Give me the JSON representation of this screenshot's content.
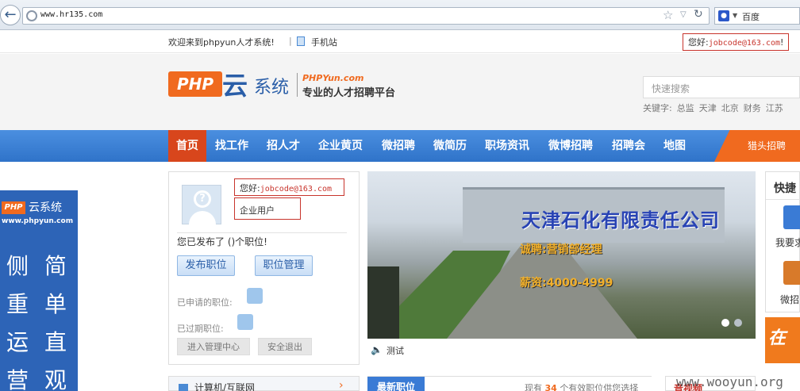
{
  "browser": {
    "url": "www.hr135.com",
    "search_engine": "百度"
  },
  "topstrip": {
    "welcome": "欢迎来到phpyun人才系统!",
    "separator": "|",
    "mobile_link": "手机站",
    "hello_prefix": "您好:",
    "hello_user": "jobcode@163.com",
    "hello_suffix": "!"
  },
  "header": {
    "logo_php": "PHP",
    "logo_yun": "云",
    "logo_sys": "系统",
    "logo_sub": "PHPYun.com",
    "logo_slogan": "专业的人才招聘平台",
    "search_placeholder": "快速搜索",
    "keywords_label": "关键字:",
    "keywords": [
      "总监",
      "天津",
      "北京",
      "财务",
      "江苏"
    ]
  },
  "nav": {
    "items": [
      "首页",
      "找工作",
      "招人才",
      "企业黄页",
      "微招聘",
      "微简历",
      "职场资讯",
      "微博招聘",
      "招聘会",
      "地图"
    ],
    "hunter": "猎头招聘"
  },
  "sidead": {
    "brand_php": "PHP",
    "brand_text": "云系统",
    "url": "www.phpyun.com",
    "chars": [
      "侧",
      "简",
      "重",
      "单",
      "运",
      "直",
      "营",
      "观"
    ]
  },
  "userpanel": {
    "hello_prefix": "您好:",
    "user": "jobcode@163.com",
    "user_type": "企业用户",
    "published": "您已发布了 ()个职位!",
    "publish_button": "发布职位",
    "manage_button": "职位管理",
    "applied_label": "已申请的职位:",
    "expired_label": "已过期职位:",
    "enter_admin": "进入管理中心",
    "logout": "安全退出"
  },
  "banner": {
    "title": "天津石化有限责任公司",
    "job": "诚聘:营销部经理",
    "pay": "薪资:4000-4999",
    "caption": "测试",
    "speaker_icon": "speaker-icon"
  },
  "quicknav": {
    "title": "快捷",
    "item1": "我要求",
    "item2": "微招"
  },
  "orangead": {
    "text": "在"
  },
  "bottom": {
    "category": "计算机/互联网",
    "job_tab": "最新职位",
    "jobcount_prefix": "现有",
    "jobcount_num": "34",
    "jobcount_suffix": "个有效职位供您选择",
    "aud_label": "音视频",
    "watermark": "www.wooyun.org"
  },
  "colors": {
    "nav_blue": "#3a7bd5",
    "brand_orange": "#f06a1f",
    "highlight_red": "#c8342c"
  }
}
